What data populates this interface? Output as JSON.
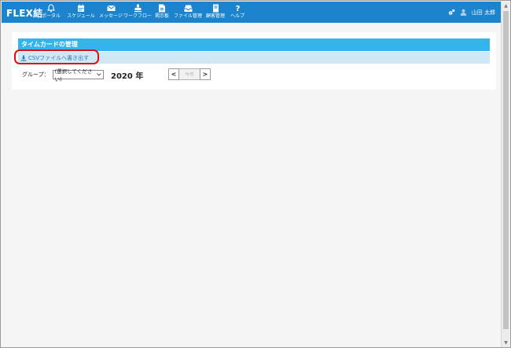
{
  "app": {
    "logo": "FLEX結"
  },
  "nav": [
    {
      "label": "ポータル",
      "icon": "bell-icon"
    },
    {
      "label": "スケジュール",
      "icon": "calendar-icon"
    },
    {
      "label": "メッセージ",
      "icon": "envelope-icon"
    },
    {
      "label": "ワークフロー",
      "icon": "stamp-icon"
    },
    {
      "label": "掲示板",
      "icon": "board-icon"
    },
    {
      "label": "ファイル管理",
      "icon": "inbox-icon"
    },
    {
      "label": "顧客管理",
      "icon": "book-icon"
    },
    {
      "label": "ヘルプ",
      "icon": "question-icon"
    }
  ],
  "user": {
    "name": "山田 太郎"
  },
  "panel": {
    "title": "タイムカードの管理",
    "csv_export": "CSVファイルへ書き出す",
    "group_label": "グループ：",
    "group_selected": "(選択してください)",
    "year": "2020 年",
    "prev": "<",
    "current": "今年",
    "next": ">"
  },
  "colors": {
    "topbar": "#1b84cc",
    "panel_title": "#34b4ec",
    "toolbar": "#cfe8f3",
    "highlight": "#e01010"
  }
}
